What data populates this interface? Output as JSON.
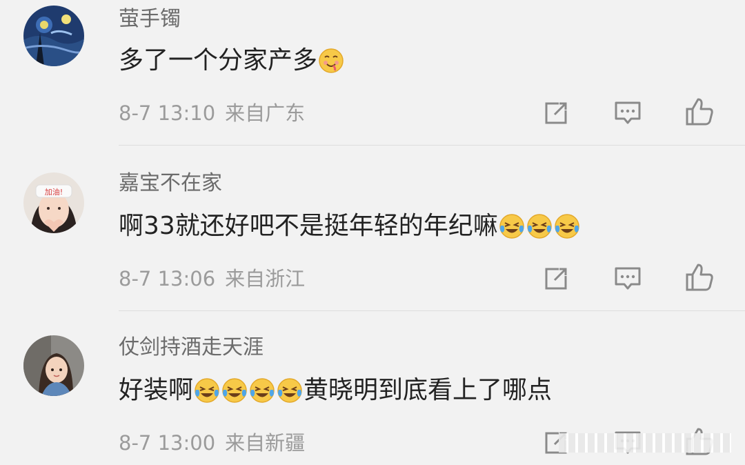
{
  "comments": [
    {
      "username": "萤手镯",
      "text_parts": [
        "多了一个分家产多"
      ],
      "time": "8-7 13:10",
      "location": "来自广东",
      "avatar_icon": "starry-night-avatar",
      "emoji": "yummy-face-emoji"
    },
    {
      "username": "嘉宝不在家",
      "text_parts": [
        "啊33就还好吧不是挺年轻的年纪嘛"
      ],
      "time": "8-7 13:06",
      "location": "来自浙江",
      "avatar_icon": "girl-heart-hands-avatar",
      "emoji": "laughing-crying-emoji"
    },
    {
      "username": "仗剑持酒走天涯",
      "text_parts": [
        "好装啊",
        "黄晓明到底看上了哪点"
      ],
      "time": "8-7 13:00",
      "location": "来自新疆",
      "avatar_icon": "cartoon-girl-avatar",
      "emoji": "laughing-crying-emoji"
    }
  ],
  "actions": [
    "repost-icon",
    "reply-icon",
    "like-icon"
  ],
  "colors": {
    "background": "#f2f2f2",
    "username": "#6b6b6b",
    "text": "#222222",
    "meta": "#9b9b9b",
    "icon": "#8a8a8a",
    "divider": "#dddddd"
  }
}
